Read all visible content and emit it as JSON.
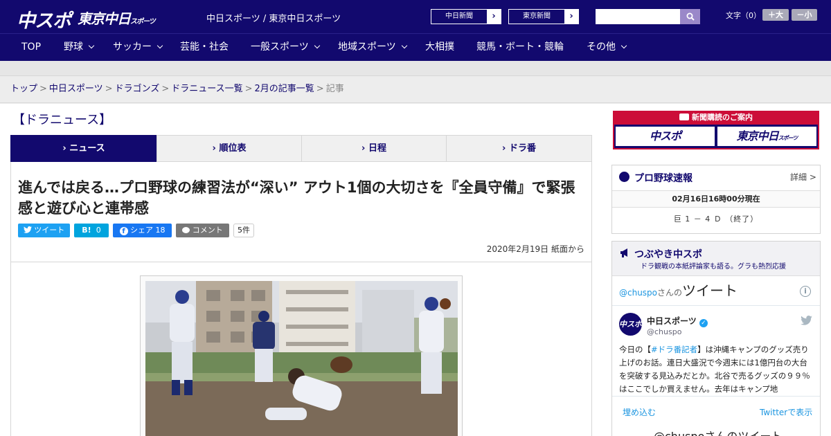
{
  "header": {
    "logo_chuspo": "中スポ",
    "logo_tokyo": "東京中日",
    "logo_tokyo_small": "スポーツ",
    "site_title": "中日スポーツ / 東京中日スポーツ",
    "ext_links": [
      {
        "label": "中日新聞"
      },
      {
        "label": "東京新聞"
      }
    ],
    "search_placeholder": "",
    "textsize_label": "文字（0）",
    "textsize_plus": "＋大",
    "textsize_minus": "－小"
  },
  "nav": {
    "items": [
      {
        "label": "TOP",
        "dropdown": false
      },
      {
        "label": "野球",
        "dropdown": true
      },
      {
        "label": "サッカー",
        "dropdown": true
      },
      {
        "label": "芸能・社会",
        "dropdown": false
      },
      {
        "label": "一般スポーツ",
        "dropdown": true
      },
      {
        "label": "地域スポーツ",
        "dropdown": true
      },
      {
        "label": "大相撲",
        "dropdown": false
      },
      {
        "label": "競馬・ボート・競輪",
        "dropdown": false
      },
      {
        "label": "その他",
        "dropdown": true
      }
    ]
  },
  "breadcrumb": {
    "links": [
      "トップ",
      "中日スポーツ",
      "ドラゴンズ",
      "ドラニュース一覧",
      "2月の記事一覧"
    ],
    "current": "記事",
    "separator": ">"
  },
  "section_title": "【ドラニュース】",
  "tabs": [
    {
      "label": "ニュース",
      "active": true
    },
    {
      "label": "順位表",
      "active": false
    },
    {
      "label": "日程",
      "active": false
    },
    {
      "label": "ドラ番",
      "active": false
    }
  ],
  "article": {
    "headline": "進んでは戻る…プロ野球の練習法が“深い” アウト1個の大切さを『全員守備』で緊張感と遊び心と連帯感",
    "share": {
      "tweet_label": "ツイート",
      "hatena_label": "B!",
      "hatena_count": "0",
      "fb_label": "シェア",
      "fb_count": "18",
      "comment_label": "コメント",
      "comment_count": "5件"
    },
    "date": "2020年2月19日 紙面から"
  },
  "sidebar": {
    "subscribe": {
      "header": "新聞購読のご案内",
      "logo_chuspo": "中スポ",
      "logo_tokyo": "東京中日",
      "logo_tokyo_small": "スポーツ"
    },
    "scores": {
      "title": "プロ野球速報",
      "detail_link": "詳細 >",
      "timestamp": "02月16日16時00分現在",
      "game": "巨 1 － 4 Ｄ （終了）"
    },
    "tweets": {
      "title": "つぶやき中スポ",
      "subtitle": "ドラ観戦の本紙評論家も語る。グラも熱烈応援",
      "embed_handle": "@chuspo",
      "embed_san": "さんの",
      "embed_label": "ツイート",
      "avatar_text": "中スポ",
      "account_name": "中日スポーツ",
      "account_handle": "@chuspo",
      "tweet_pre": "今日の【",
      "tweet_tag": "#ドラ番記者",
      "tweet_post": "】は沖縄キャンプのグッズ売り上げのお話。連日大盛況で今週末には1億円台の大台を突破する見込みだとか。北谷で売るグッズの９９％はここでしか買えません。去年はキャンプ地",
      "embed_link": "埋め込む",
      "view_link": "Twitterで表示",
      "next_header": "@chuspoさんのツイート"
    }
  },
  "colors": {
    "brand_navy": "#12096e",
    "accent_red": "#cc0d38",
    "twitter_blue": "#1da1f2",
    "hatena_blue": "#00a4de",
    "facebook_blue": "#1877f2",
    "comment_grey": "#777777"
  }
}
